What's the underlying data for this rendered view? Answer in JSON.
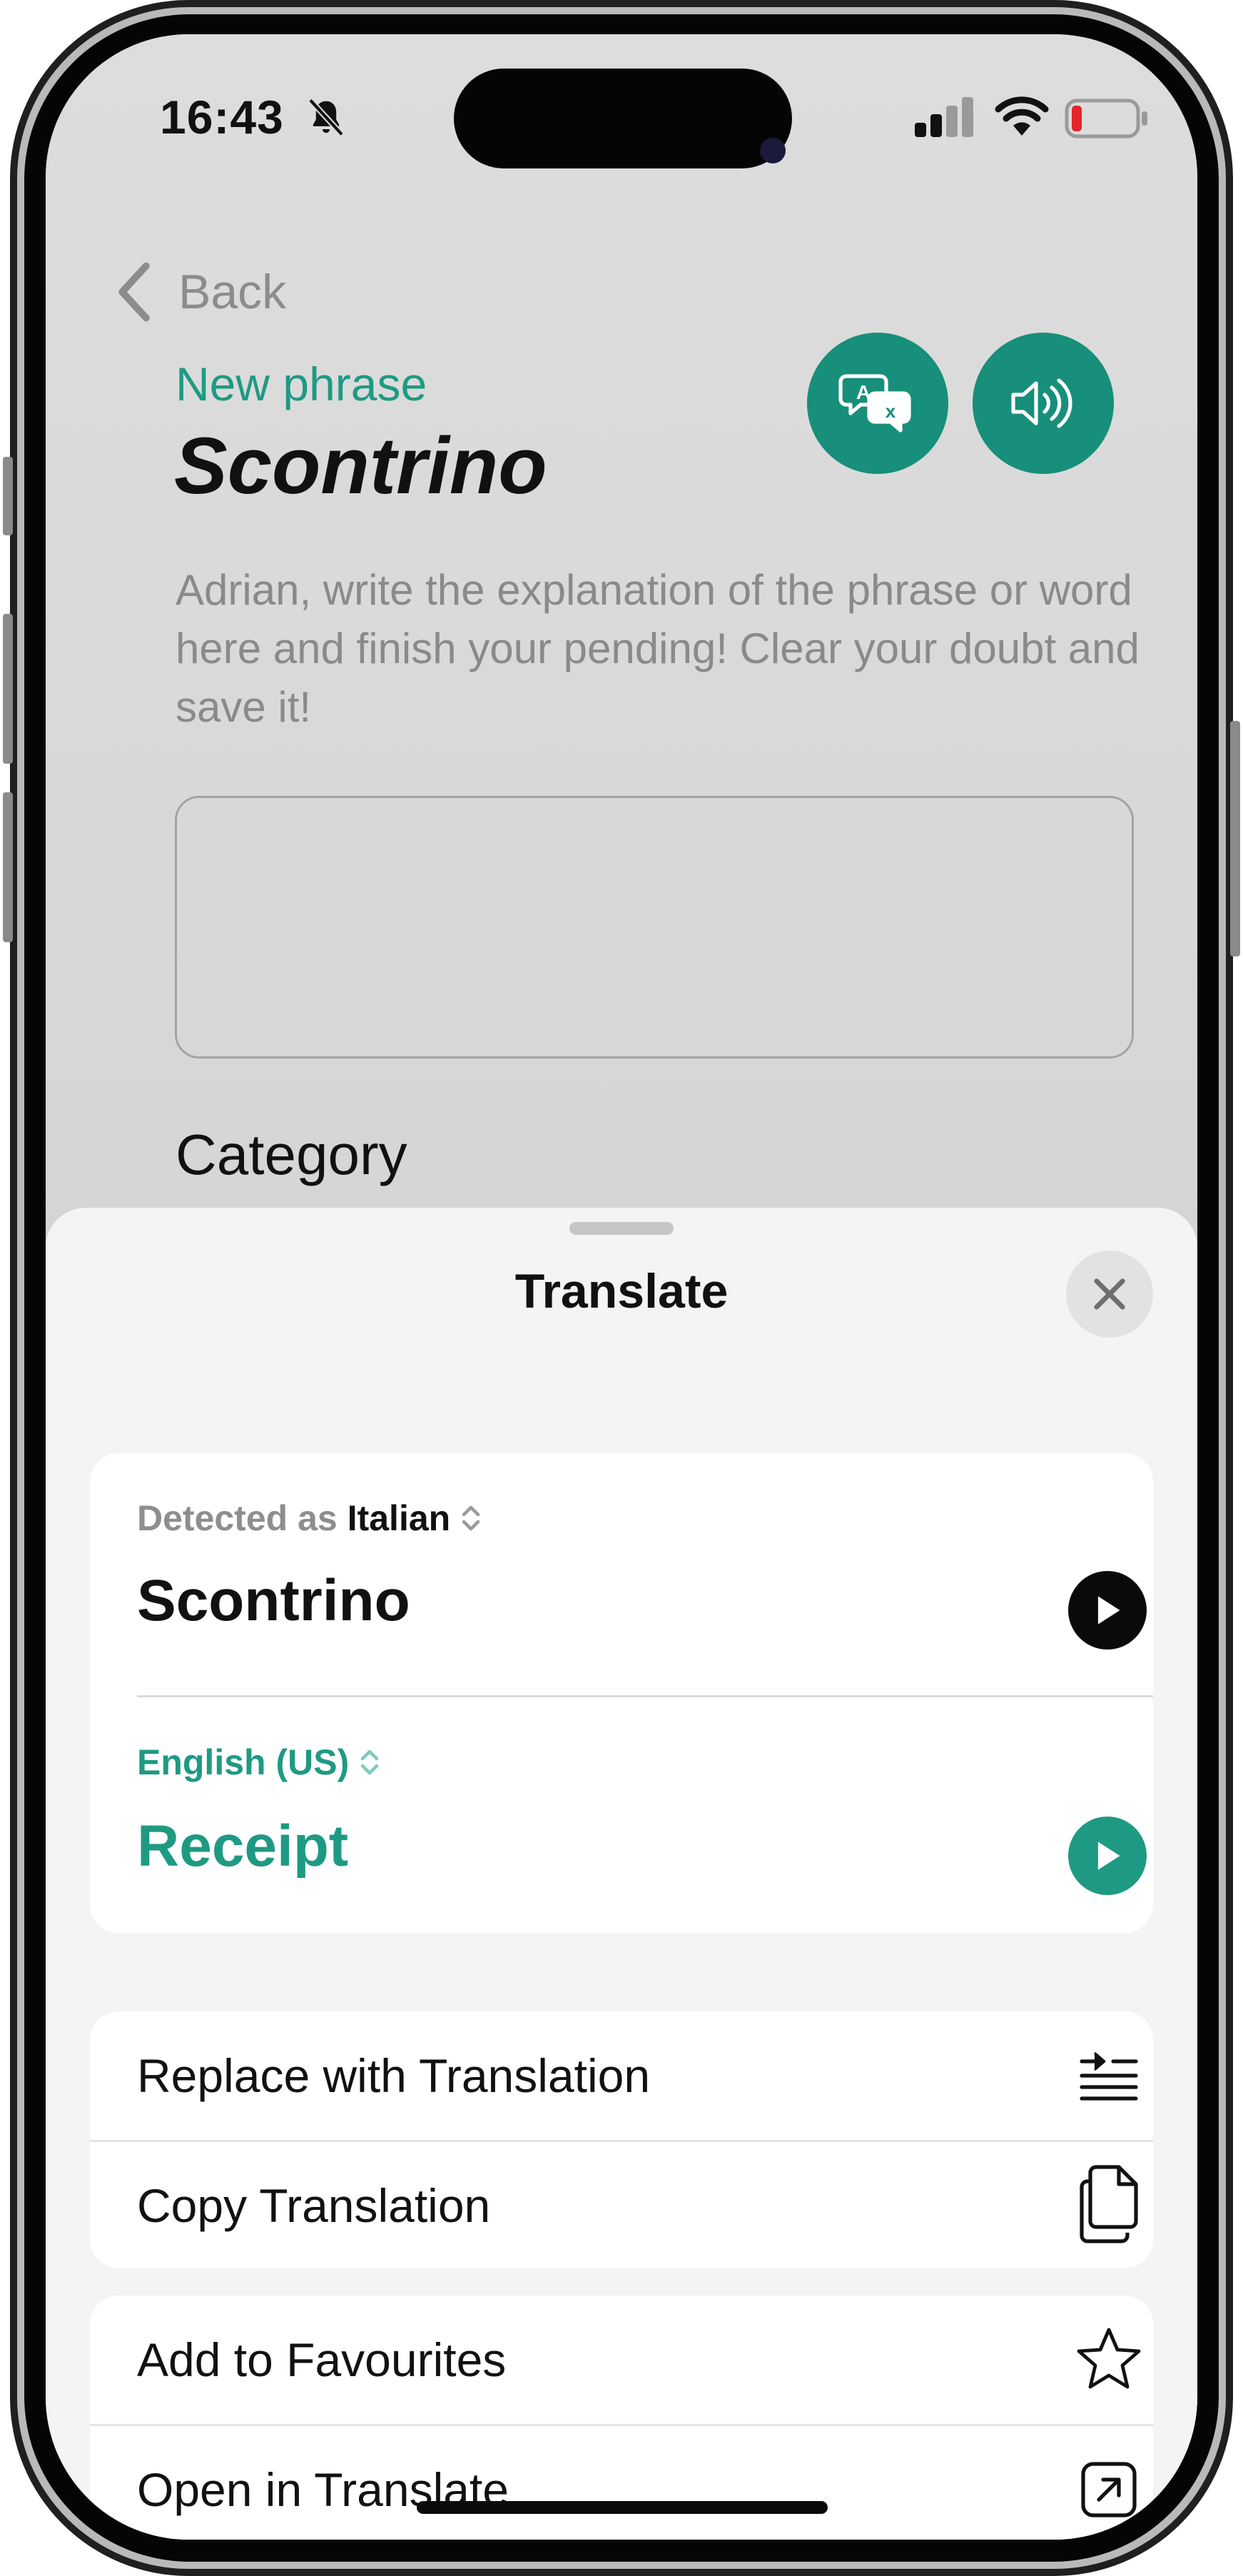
{
  "status_bar": {
    "time": "16:43",
    "icons": [
      "bell-slash-icon",
      "signal-icon",
      "wifi-icon",
      "battery-low-icon"
    ],
    "battery_color": "#e5242b"
  },
  "background_screen": {
    "back_label": "Back",
    "subtitle": "New phrase",
    "title": "Scontrino",
    "actions": [
      "translate-icon",
      "speaker-icon"
    ],
    "explanation": "Adrian, write the explanation of the phrase or word here and finish your pending! Clear your doubt and save it!",
    "text_area_value": "",
    "category_label": "Category"
  },
  "sheet": {
    "title": "Translate",
    "source": {
      "detected_prefix": "Detected as",
      "language": "Italian",
      "text": "Scontrino"
    },
    "target": {
      "language": "English (US)",
      "text": "Receipt"
    },
    "actions_group_1": [
      {
        "label": "Replace with Translation",
        "icon": "replace-lines-icon"
      },
      {
        "label": "Copy Translation",
        "icon": "copy-icon"
      }
    ],
    "actions_group_2": [
      {
        "label": "Add to Favourites",
        "icon": "star-icon"
      },
      {
        "label": "Open in Translate",
        "icon": "open-external-icon"
      }
    ]
  },
  "colors": {
    "accent": "#1e9a83",
    "accent_button": "#178f7a",
    "sheet_background": "#f4f4f4",
    "card_background": "#ffffff"
  }
}
